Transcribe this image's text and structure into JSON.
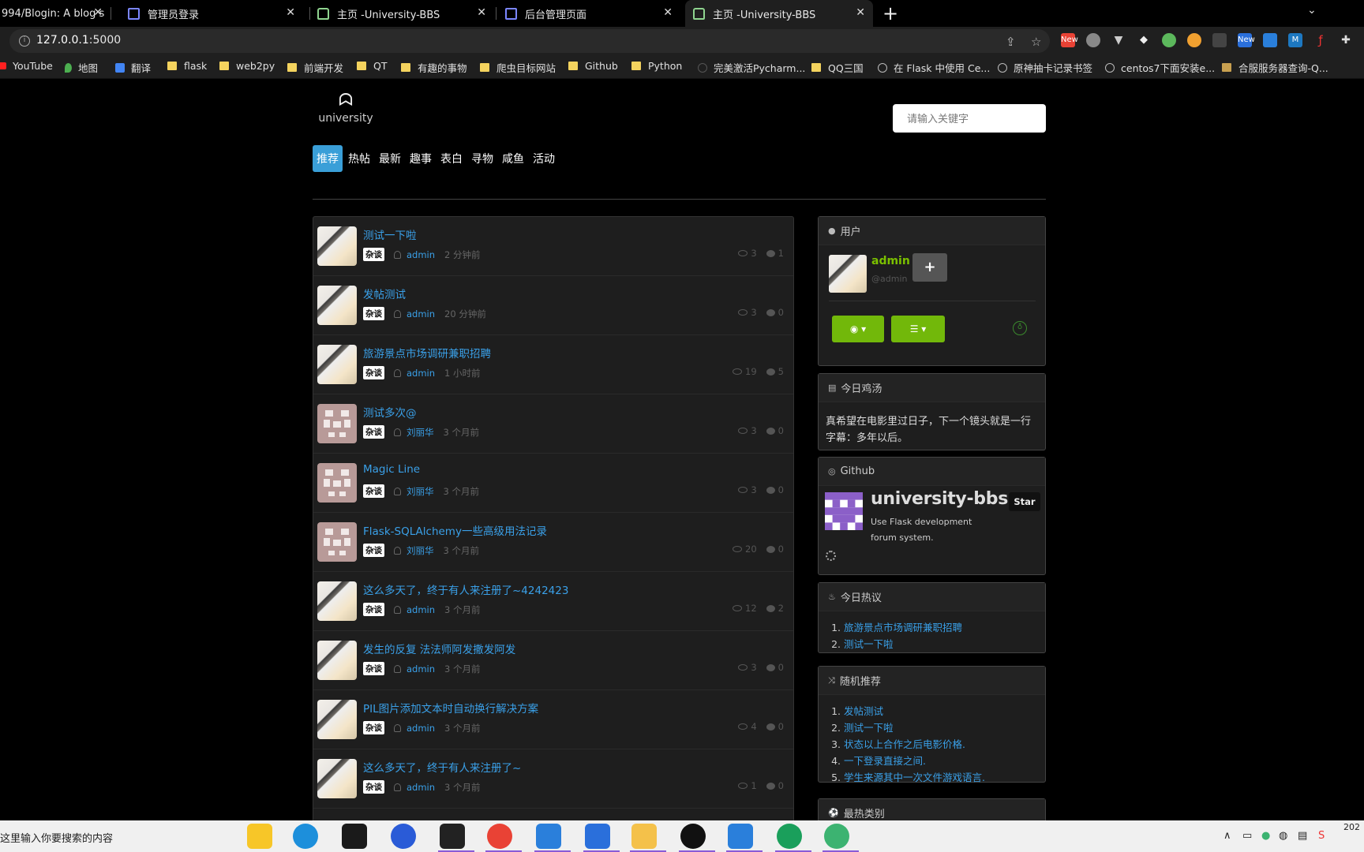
{
  "browser": {
    "tabs": [
      {
        "title": "994/Blogin: A blog s",
        "type": "github"
      },
      {
        "title": "管理员登录",
        "type": "page"
      },
      {
        "title": "主页 -University-BBS",
        "type": "bbs"
      },
      {
        "title": "后台管理页面",
        "type": "page"
      },
      {
        "title": "主页 -University-BBS",
        "type": "bbs",
        "active": true
      }
    ],
    "url_host": "127.0.0.1",
    "url_port": ":5000",
    "bookmarks": [
      {
        "label": "YouTube",
        "icon": "youtube-icon"
      },
      {
        "label": "地图",
        "icon": "maps-icon"
      },
      {
        "label": "翻译",
        "icon": "translate-icon"
      },
      {
        "label": "flask",
        "icon": "folder-icon"
      },
      {
        "label": "web2py",
        "icon": "folder-icon"
      },
      {
        "label": "前端开发",
        "icon": "folder-icon"
      },
      {
        "label": "QT",
        "icon": "folder-icon"
      },
      {
        "label": "有趣的事物",
        "icon": "folder-icon"
      },
      {
        "label": "爬虫目标网站",
        "icon": "folder-icon"
      },
      {
        "label": "Github",
        "icon": "folder-icon"
      },
      {
        "label": "Python",
        "icon": "folder-icon"
      },
      {
        "label": "完美激活Pycharm...",
        "icon": "page-icon"
      },
      {
        "label": "QQ三国",
        "icon": "folder-icon"
      },
      {
        "label": "在 Flask 中使用 Ce...",
        "icon": "globe-icon"
      },
      {
        "label": "原神抽卡记录书签",
        "icon": "globe-icon"
      },
      {
        "label": "centos7下面安装e...",
        "icon": "globe-icon"
      },
      {
        "label": "合服服务器查询-Q...",
        "icon": "image-icon"
      }
    ],
    "extension_badges": [
      "New",
      "New",
      "M"
    ]
  },
  "site": {
    "logo_text": "university",
    "search_placeholder": "请输入关键字",
    "nav": [
      "推荐",
      "热帖",
      "最新",
      "趣事",
      "表白",
      "寻物",
      "咸鱼",
      "活动"
    ],
    "active_nav": "推荐"
  },
  "posts": [
    {
      "title": "测试一下啦",
      "tag": "杂谈",
      "author": "admin",
      "time": "2 分钟前",
      "views": "3",
      "comments": "1",
      "avatar": "anime"
    },
    {
      "title": "发帖测试",
      "tag": "杂谈",
      "author": "admin",
      "time": "20 分钟前",
      "views": "3",
      "comments": "0",
      "avatar": "anime"
    },
    {
      "title": "旅游景点市场调研兼职招聘",
      "tag": "杂谈",
      "author": "admin",
      "time": "1 小时前",
      "views": "19",
      "comments": "5",
      "avatar": "anime"
    },
    {
      "title": "测试多次@",
      "tag": "杂谈",
      "author": "刘丽华",
      "time": "3 个月前",
      "views": "3",
      "comments": "0",
      "avatar": "pixel"
    },
    {
      "title": "Magic Line",
      "tag": "杂谈",
      "author": "刘丽华",
      "time": "3 个月前",
      "views": "3",
      "comments": "0",
      "avatar": "pixel"
    },
    {
      "title": "Flask-SQLAlchemy一些高级用法记录",
      "tag": "杂谈",
      "author": "刘丽华",
      "time": "3 个月前",
      "views": "20",
      "comments": "0",
      "avatar": "pixel"
    },
    {
      "title": "这么多天了，终于有人来注册了~4242423",
      "tag": "杂谈",
      "author": "admin",
      "time": "3 个月前",
      "views": "12",
      "comments": "2",
      "avatar": "anime"
    },
    {
      "title": "发生的反复 法法师阿发撒发阿发",
      "tag": "杂谈",
      "author": "admin",
      "time": "3 个月前",
      "views": "3",
      "comments": "0",
      "avatar": "anime"
    },
    {
      "title": "PIL图片添加文本时自动换行解决方案",
      "tag": "杂谈",
      "author": "admin",
      "time": "3 个月前",
      "views": "4",
      "comments": "0",
      "avatar": "anime"
    },
    {
      "title": "这么多天了，终于有人来注册了~",
      "tag": "杂谈",
      "author": "admin",
      "time": "3 个月前",
      "views": "1",
      "comments": "0",
      "avatar": "anime"
    }
  ],
  "sidebar": {
    "user_header": "用户",
    "username": "admin",
    "handle": "@admin",
    "follow_label": "+",
    "dashboard_icon": "dashboard-icon",
    "menu_icon": "list-icon",
    "quote_header": "今日鸡汤",
    "quote": "真希望在电影里过日子，下一个镜头就是一行字幕：多年以后。",
    "github_header": "Github",
    "repo_name": "university-bbs",
    "repo_desc": "Use Flask development forum system.",
    "star_label": "Star",
    "hot_header": "今日热议",
    "hot_list": [
      "旅游景点市场调研兼职招聘",
      "测试一下啦"
    ],
    "random_header": "随机推荐",
    "random_list": [
      "发帖测试",
      "测试一下啦",
      "状态以上合作之后电影价格.",
      "一下登录直接之间.",
      "学生来源其中一次文件游戏语言."
    ],
    "category_header": "最热类别"
  },
  "taskbar": {
    "search_placeholder": "在这里输入你要搜索的内容",
    "clock_year": "202"
  },
  "colors": {
    "accent_blue": "#3aa0e8",
    "nav_active": "#3a9fd8",
    "green": "#72b80a"
  }
}
